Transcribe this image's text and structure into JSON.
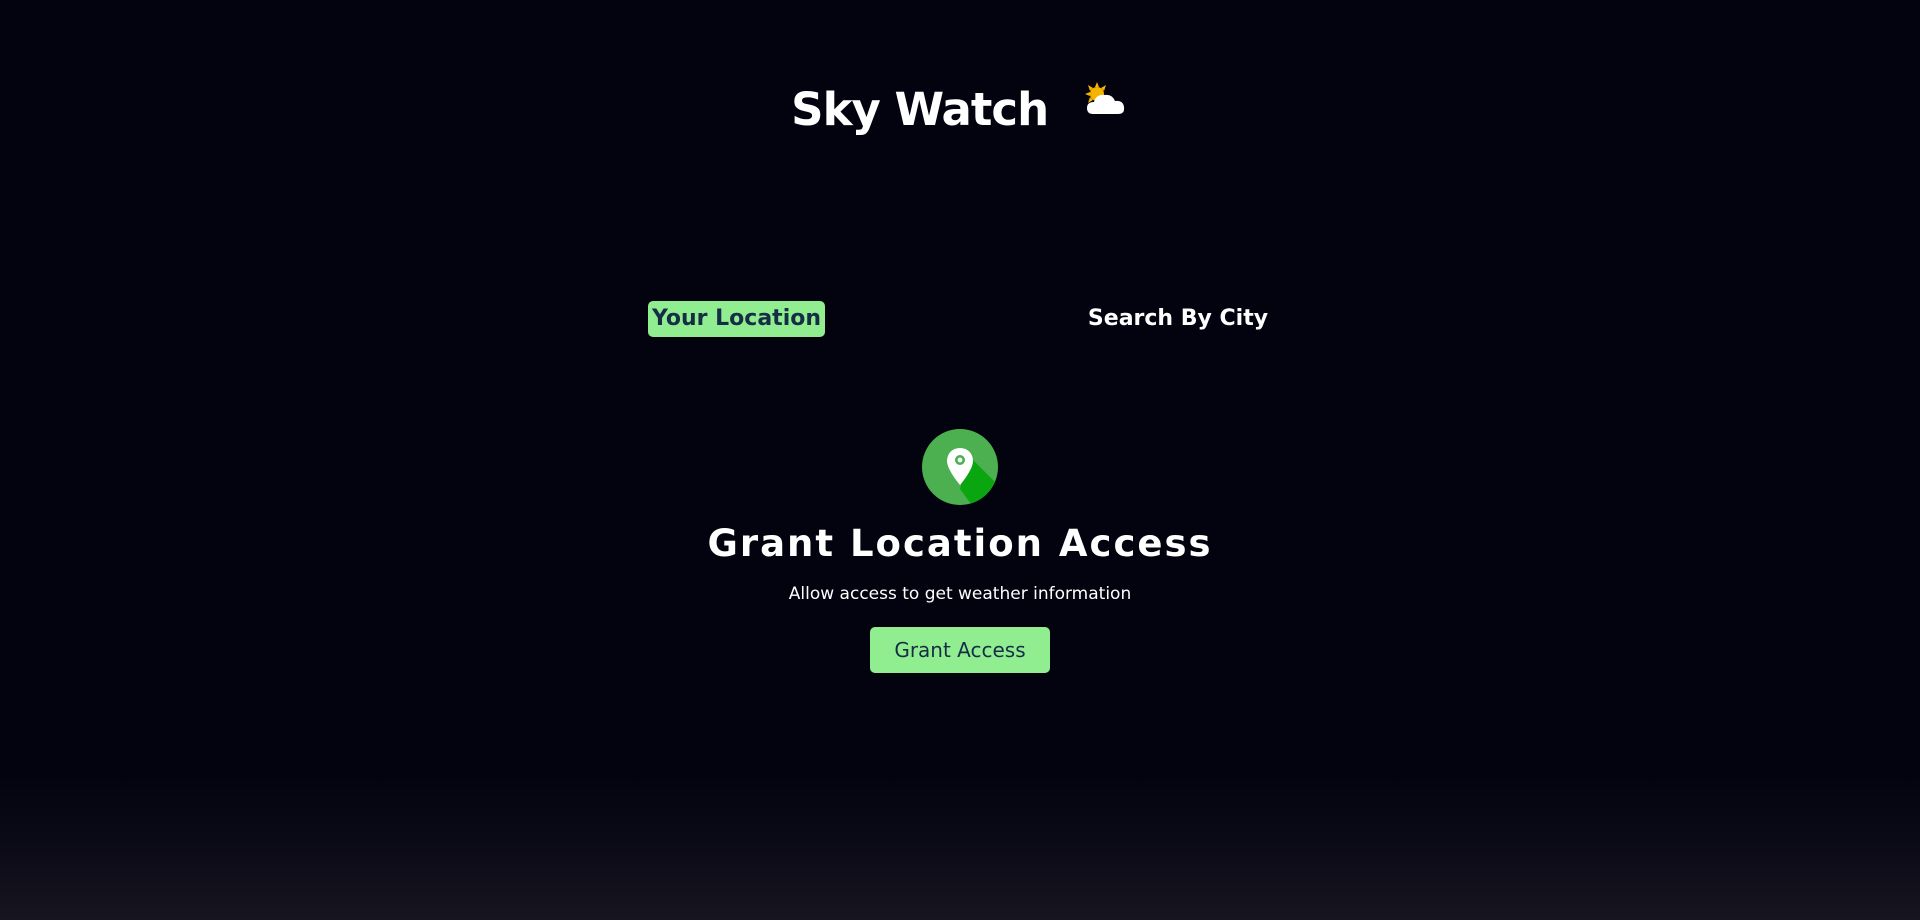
{
  "header": {
    "title": "Sky Watch",
    "title_icon": "sun-behind-cloud-icon"
  },
  "tabs": [
    {
      "label": "Your Location",
      "active": true
    },
    {
      "label": "Search By City",
      "active": false
    }
  ],
  "grant": {
    "icon": "location-pin-icon",
    "heading": "Grant Location Access",
    "description": "Allow access to get weather information",
    "button_label": "Grant Access"
  },
  "colors": {
    "background": "#03020f",
    "accent": "#90ee90",
    "accent_text": "#162e45",
    "icon_green": "#4caf50",
    "icon_shadow": "#0aa60f",
    "text": "#ffffff"
  }
}
